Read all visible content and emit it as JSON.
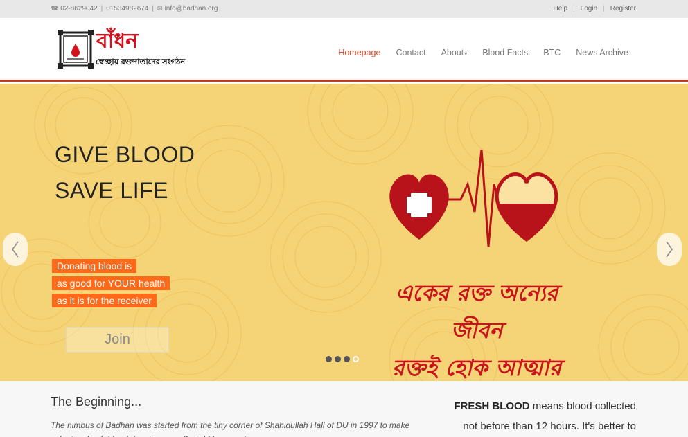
{
  "topbar": {
    "phone1": "02-8629042",
    "phone2": "01534982674",
    "email": "info@badhan.org",
    "links": [
      "Help",
      "Login",
      "Register"
    ]
  },
  "logo": {
    "brand": "বাঁধন",
    "tagline": "স্বেচ্ছায় রক্তদাতাদের সংগঠন"
  },
  "nav": {
    "items": [
      {
        "label": "Homepage",
        "active": true
      },
      {
        "label": "Contact"
      },
      {
        "label": "About",
        "dropdown": true
      },
      {
        "label": "Blood Facts"
      },
      {
        "label": "BTC"
      },
      {
        "label": "News Archive"
      }
    ]
  },
  "hero": {
    "headline_line1": "GIVE BLOOD",
    "headline_line2": "SAVE LIFE",
    "tagline": [
      "Donating blood is",
      "as good for YOUR health",
      "as it is for the receiver"
    ],
    "join_label": "Join",
    "slogan_line1": "একের রক্ত অন্যের জীবন",
    "slogan_line2": "রক্তই হোক আত্মার বাঁধন",
    "slides_total": 4,
    "slide_active": 4,
    "colors": {
      "background": "#f5d377",
      "accent": "#ff6a1a",
      "heart": "#c8141c"
    }
  },
  "content": {
    "beginning_title": "The Beginning...",
    "beginning_text": "The nimbus of Badhan was started from the tiny corner of Shahidullah Hall of DU in 1997 to make voluntary fresh blood donation as a Social Movement.",
    "fresh_bold": "FRESH BLOOD",
    "fresh_text": " means blood collected not before than 12 hours. It's better to transfuse"
  }
}
